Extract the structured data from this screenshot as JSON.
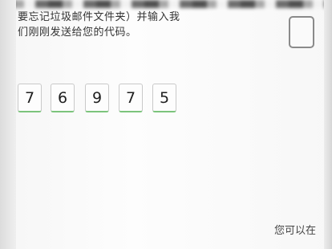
{
  "instruction": {
    "line1": "要忘记垃圾邮件文件夹）并输入我",
    "line2": "们刚刚发送给您的代码。"
  },
  "code": {
    "digits": [
      "7",
      "6",
      "9",
      "7",
      "5"
    ]
  },
  "footer": {
    "partial_text": "您可以在"
  },
  "colors": {
    "accent_underline": "#7cc47c",
    "background": "#f6f6f6"
  }
}
